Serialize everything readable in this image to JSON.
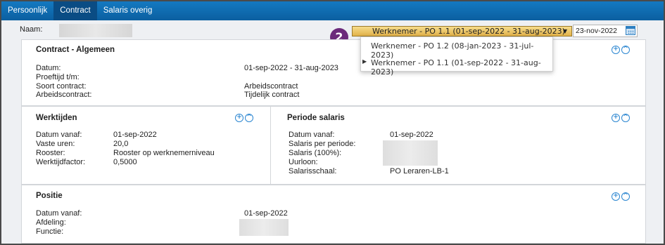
{
  "tabs": [
    {
      "label": "Persoonlijk"
    },
    {
      "label": "Contract"
    },
    {
      "label": "Salaris overig"
    }
  ],
  "header": {
    "naam_label": "Naam:",
    "step_badge": "2",
    "contract_select": "Werknemer - PO 1.1 (01-sep-2022 - 31-aug-2023)",
    "date": "23-nov-2022"
  },
  "dropdown": {
    "items": [
      {
        "label": "Werknemer - PO 1.2 (08-jan-2023 - 31-jul-2023)"
      },
      {
        "label": "Werknemer - PO 1.1 (01-sep-2022 - 31-aug-2023)"
      }
    ]
  },
  "contract": {
    "title": "Contract - Algemeen",
    "datum_label": "Datum:",
    "datum_value": "01-sep-2022 - 31-aug-2023",
    "proeftijd_label": "Proeftijd t/m:",
    "soort_label": "Soort contract:",
    "soort_value": "Arbeidscontract",
    "arbeid_label": "Arbeidscontract:",
    "arbeid_value": "Tijdelijk contract"
  },
  "werktijden": {
    "title": "Werktijden",
    "vanaf_label": "Datum vanaf:",
    "vanaf_value": "01-sep-2022",
    "uren_label": "Vaste uren:",
    "uren_value": "20,0",
    "rooster_label": "Rooster:",
    "rooster_value": "Rooster op werknemerniveau",
    "factor_label": "Werktijdfactor:",
    "factor_value": "0,5000"
  },
  "salaris": {
    "title": "Periode salaris",
    "vanaf_label": "Datum vanaf:",
    "vanaf_value": "01-sep-2022",
    "per_periode_label": "Salaris per periode:",
    "salaris100_label": "Salaris (100%):",
    "uurloon_label": "Uurloon:",
    "schaal_label": "Salarisschaal:",
    "schaal_value": "PO Leraren-LB-1"
  },
  "positie": {
    "title": "Positie",
    "vanaf_label": "Datum vanaf:",
    "vanaf_value": "01-sep-2022",
    "afdeling_label": "Afdeling:",
    "functie_label": "Functie:"
  },
  "icons": {
    "zoom": "zoom-in-icon",
    "collapse": "collapse-up-icon"
  }
}
